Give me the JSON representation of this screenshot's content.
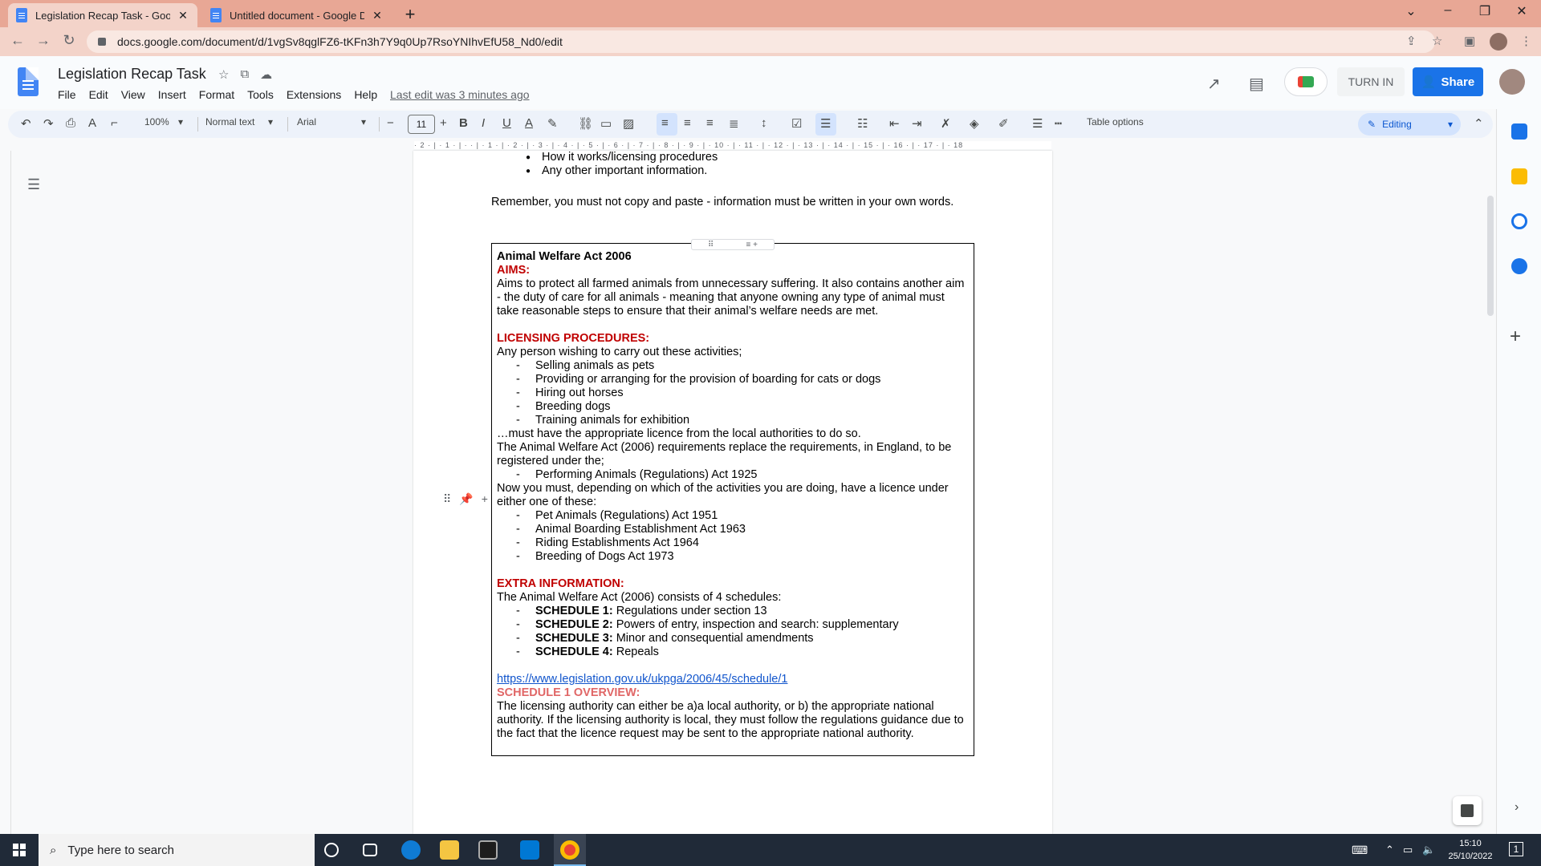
{
  "browser": {
    "tabs": [
      {
        "title": "Legislation Recap Task - Google D"
      },
      {
        "title": "Untitled document - Google Doc"
      }
    ],
    "url": "docs.google.com/document/d/1vgSv8qglFZ6-tKFn3h7Y9q0Up7RsoYNIhvEfU58_Nd0/edit"
  },
  "docs": {
    "title": "Legislation Recap Task",
    "menus": [
      "File",
      "Edit",
      "View",
      "Insert",
      "Format",
      "Tools",
      "Extensions",
      "Help"
    ],
    "last_edit": "Last edit was 3 minutes ago",
    "turn_in": "TURN IN",
    "share": "Share"
  },
  "toolbar": {
    "zoom": "100%",
    "style": "Normal text",
    "font": "Arial",
    "font_size": "11",
    "table_options": "Table options",
    "mode": "Editing"
  },
  "ruler": "· 2 · | · 1 · | ·   · | · 1 · | · 2 · | · 3 · | · 4 · | · 5 · | · 6 · | · 7 · | · 8 · | · 9 · | · 10 · | · 11 · | · 12 · | · 13 · | · 14 · | · 15 · | · 16 · | · 17 · | · 18",
  "content": {
    "bullets": [
      "How it works/licensing procedures",
      "Any other important information."
    ],
    "remember": "Remember, you must not copy and paste - information must be written in your own words.",
    "act_title": "Animal Welfare Act 2006",
    "aims_heading": "AIMS:",
    "aims_text": "Aims to protect all farmed animals from unnecessary suffering. It also contains another aim - the duty of care for all animals - meaning that anyone owning any type of animal must take reasonable steps to ensure that their animal’s welfare needs are met.",
    "licensing_heading": "LICENSING PROCEDURES:",
    "licensing_intro": "Any person wishing to carry out these activities;",
    "activities": [
      "Selling animals as pets",
      "Providing or arranging for the provision of boarding for cats or dogs",
      "Hiring out horses",
      "Breeding dogs",
      "Training animals for exhibition"
    ],
    "licence_line": "…must have the appropriate licence from the local authorities to do so.",
    "replace_text": "The Animal Welfare Act (2006) requirements replace the requirements, in England, to be registered under the;",
    "performing_act": "Performing Animals (Regulations) Act 1925",
    "now_text": "Now you must, depending on which of the activities you are doing, have a licence under either one of these:",
    "acts": [
      "Pet Animals (Regulations) Act 1951",
      "Animal Boarding Establishment Act 1963",
      "Riding Establishments Act 1964",
      "Breeding of Dogs Act 1973"
    ],
    "extra_heading": "EXTRA INFORMATION:",
    "extra_intro": "The Animal Welfare Act (2006) consists of 4 schedules:",
    "schedules": [
      {
        "label": "SCHEDULE 1:",
        "text": " Regulations under section 13"
      },
      {
        "label": "SCHEDULE 2:",
        "text": " Powers of entry, inspection and search: supplementary"
      },
      {
        "label": "SCHEDULE 3:",
        "text": " Minor and consequential amendments"
      },
      {
        "label": "SCHEDULE 4:",
        "text": " Repeals"
      }
    ],
    "link": "https://www.legislation.gov.uk/ukpga/2006/45/schedule/1",
    "overview_heading": "SCHEDULE 1 OVERVIEW:",
    "overview_text": "The licensing authority can either be a)a local authority, or b) the appropriate national authority. If the licensing authority is local, they must follow the regulations guidance due to the fact that the licence request may be sent to the appropriate national authority."
  },
  "taskbar": {
    "search_placeholder": "Type here to search",
    "time": "15:10",
    "date": "25/10/2022",
    "notifications": "1"
  }
}
